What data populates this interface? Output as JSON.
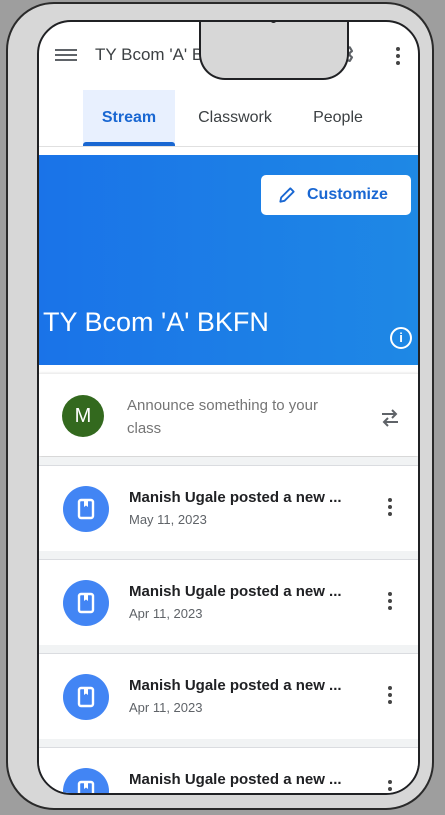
{
  "app": {
    "title": "TY Bcom 'A' BKFN"
  },
  "tabs": [
    {
      "label": "Stream"
    },
    {
      "label": "Classwork"
    },
    {
      "label": "People"
    }
  ],
  "banner": {
    "customize_label": "Customize",
    "class_title": "TY Bcom 'A' BKFN",
    "color": "#1a73e8"
  },
  "announce": {
    "avatar_letter": "M",
    "placeholder": "Announce something to your class",
    "avatar_color": "#33691e"
  },
  "posts": [
    {
      "title": "Manish Ugale posted a new ...",
      "date": "May 11, 2023"
    },
    {
      "title": "Manish Ugale posted a new ...",
      "date": "Apr 11, 2023"
    },
    {
      "title": "Manish Ugale posted a new ...",
      "date": "Apr 11, 2023"
    },
    {
      "title": "Manish Ugale posted a new ...",
      "date": ""
    }
  ],
  "icons": [
    "menu-icon",
    "gear-icon",
    "more-vert-icon",
    "edit-pencil-icon",
    "info-icon",
    "repost-icon",
    "book-icon"
  ]
}
